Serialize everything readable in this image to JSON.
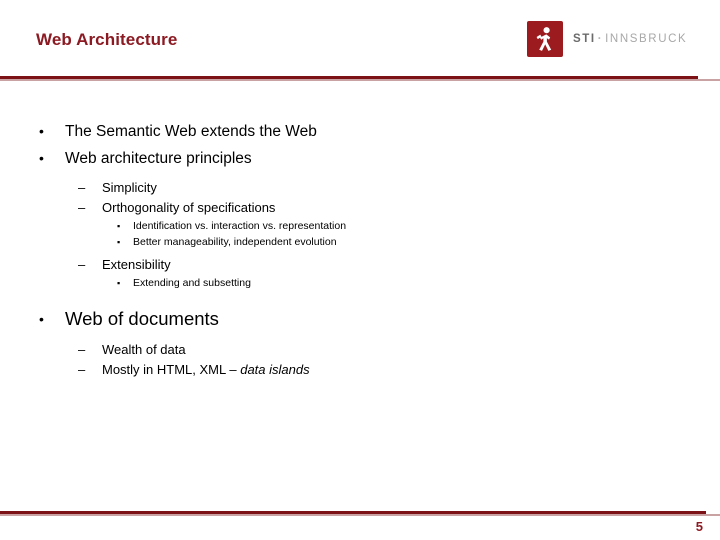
{
  "slide": {
    "title": "Web Architecture",
    "page_number": "5",
    "accent_color": "#8c1a22",
    "rule_color": "#7d1216",
    "rule_light_color": "#c9a3a3"
  },
  "logo": {
    "mark_name": "sti-figure-icon",
    "mark_color": "#9b1b1f",
    "text_sti": "STI",
    "text_separator": "·",
    "text_innsbruck": "INNSBRUCK"
  },
  "bullets": {
    "l1_marker": "•",
    "l2_marker": "–",
    "l3_marker": "▪"
  },
  "content": [
    {
      "level": 1,
      "text": "The Semantic Web extends the Web"
    },
    {
      "level": 1,
      "text": "Web architecture principles"
    },
    {
      "level": 2,
      "text": "Simplicity"
    },
    {
      "level": 2,
      "text": "Orthogonality of specifications"
    },
    {
      "level": 3,
      "text": "Identification vs. interaction vs. representation"
    },
    {
      "level": 3,
      "text": "Better manageability, independent evolution"
    },
    {
      "level": 2,
      "text": "Extensibility"
    },
    {
      "level": 3,
      "text": "Extending and subsetting"
    },
    {
      "level": 1,
      "text": "Web of documents",
      "big": true
    },
    {
      "level": 2,
      "text": "Wealth of data"
    },
    {
      "level": 2,
      "text": "Mostly in HTML, XML – ",
      "emphasis": "data islands"
    }
  ]
}
